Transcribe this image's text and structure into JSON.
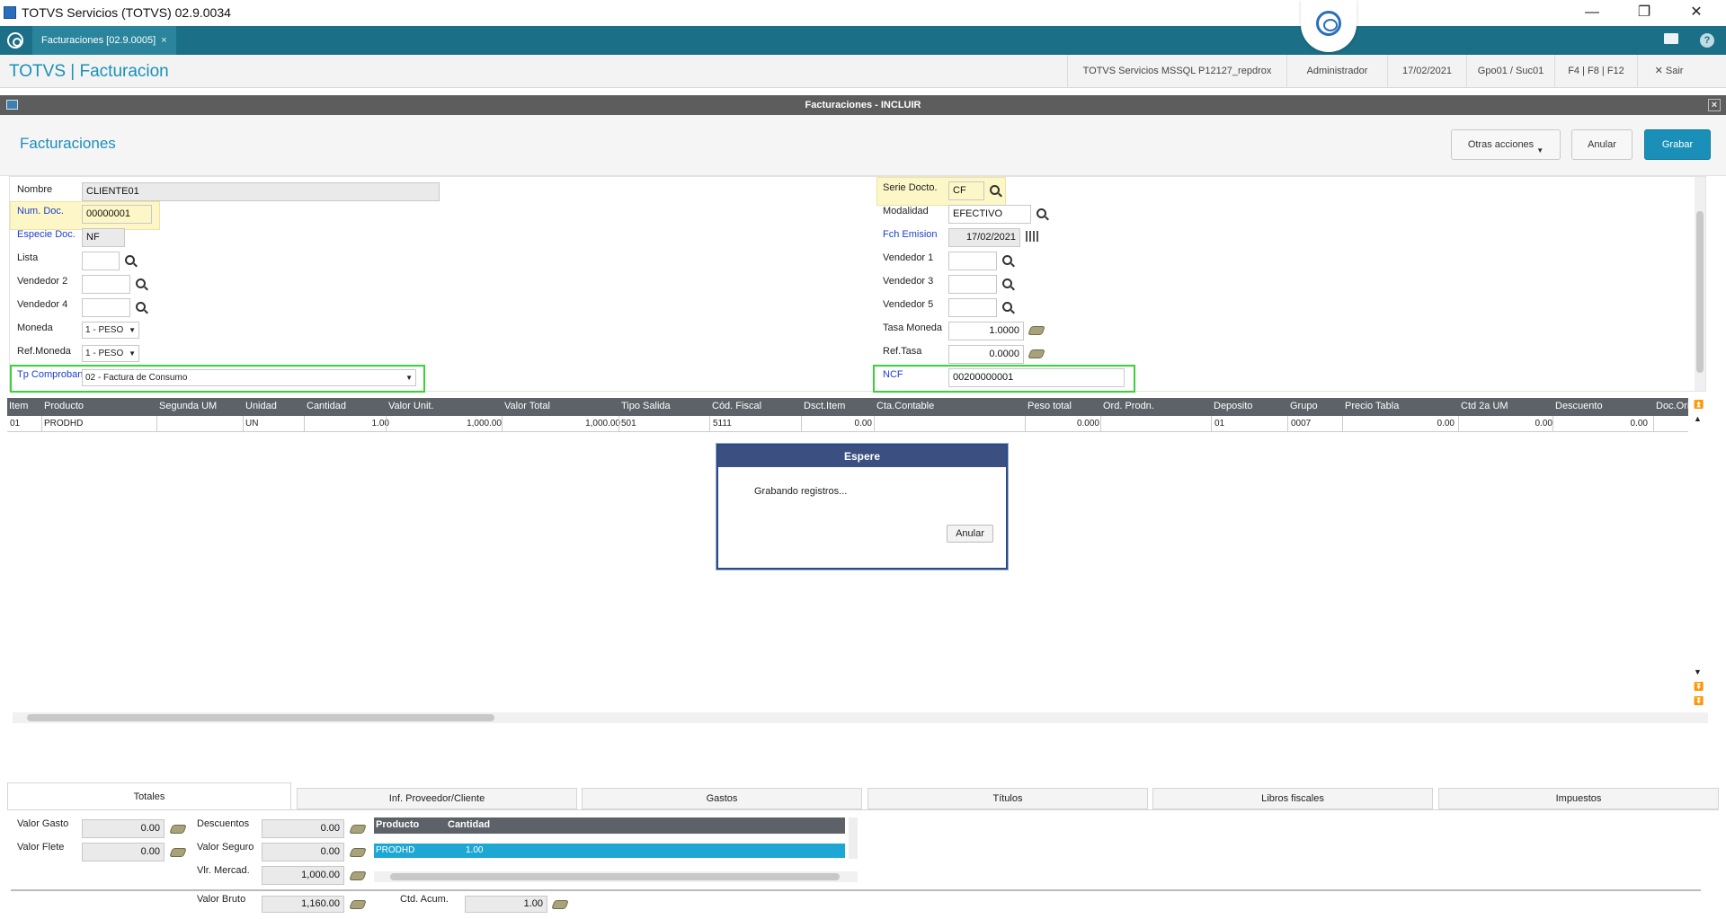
{
  "window": {
    "title": "TOTVS Servicios (TOTVS) 02.9.0034",
    "minimize": "—",
    "restore": "❐",
    "close": "✕"
  },
  "tabbar": {
    "tab_label": "Facturaciones [02.9.0005]",
    "tab_close": "×"
  },
  "header": {
    "brand": "TOTVS | Facturacion",
    "server": "TOTVS Servicios MSSQL P12127_repdrox",
    "user": "Administrador",
    "date": "17/02/2021",
    "branch": "Gpo01 / Suc01",
    "keys": "F4 | F8 | F12",
    "exit": "Sair"
  },
  "dialog": {
    "title": "Facturaciones - INCLUIR",
    "close": "×"
  },
  "form": {
    "title": "Facturaciones",
    "actions": {
      "other": "Otras acciones",
      "cancel": "Anular",
      "save": "Grabar"
    },
    "left": {
      "nombre": {
        "label": "Nombre",
        "value": "CLIENTE01"
      },
      "num_doc": {
        "label": "Num. Doc.",
        "value": "00000001"
      },
      "especie": {
        "label": "Especie Doc.",
        "value": "NF"
      },
      "lista": {
        "label": "Lista",
        "value": ""
      },
      "vendedor2": {
        "label": "Vendedor 2",
        "value": ""
      },
      "vendedor4": {
        "label": "Vendedor 4",
        "value": ""
      },
      "moneda": {
        "label": "Moneda",
        "value": "1 - PESO"
      },
      "ref_moneda": {
        "label": "Ref.Moneda",
        "value": "1 - PESO"
      },
      "tp_comprob": {
        "label": "Tp Comproban",
        "value": "02 - Factura de Consumo"
      }
    },
    "right": {
      "serie": {
        "label": "Serie Docto.",
        "value": "CF"
      },
      "modalidad": {
        "label": "Modalidad",
        "value": "EFECTIVO"
      },
      "fch_emision": {
        "label": "Fch Emision",
        "value": "17/02/2021"
      },
      "vendedor1": {
        "label": "Vendedor 1",
        "value": ""
      },
      "vendedor3": {
        "label": "Vendedor 3",
        "value": ""
      },
      "vendedor5": {
        "label": "Vendedor 5",
        "value": ""
      },
      "tasa_moneda": {
        "label": "Tasa Moneda",
        "value": "1.0000"
      },
      "ref_tasa": {
        "label": "Ref.Tasa",
        "value": "0.0000"
      },
      "ncf": {
        "label": "NCF",
        "value": "00200000001"
      }
    }
  },
  "grid": {
    "columns": [
      "Item",
      "Producto",
      "Segunda UM",
      "Unidad",
      "Cantidad",
      "Valor Unit.",
      "Valor Total",
      "Tipo Salida",
      "Cód. Fiscal",
      "Dsct.Item",
      "Cta.Contable",
      "Peso total",
      "Ord. Prodn.",
      "Deposito",
      "Grupo",
      "Precio Tabla",
      "Ctd 2a UM",
      "Descuento",
      "Doc.Origi"
    ],
    "rows": [
      [
        "01",
        "PRODHD",
        "",
        "UN",
        "1.00",
        "1,000.00",
        "1,000.00",
        "501",
        "5111",
        "0.00",
        "",
        "0.000",
        "",
        "01",
        "0007",
        "0.00",
        "0.00",
        "0.00",
        ""
      ]
    ]
  },
  "wait_dialog": {
    "title": "Espere",
    "message": "Grabando registros...",
    "cancel": "Anular"
  },
  "bottom_tabs": [
    "Totales",
    "Inf. Proveedor/Cliente",
    "Gastos",
    "Títulos",
    "Libros fiscales",
    "Impuestos"
  ],
  "totals": {
    "valor_gasto": {
      "label": "Valor Gasto",
      "value": "0.00"
    },
    "valor_flete": {
      "label": "Valor Flete",
      "value": "0.00"
    },
    "descuentos": {
      "label": "Descuentos",
      "value": "0.00"
    },
    "valor_seguro": {
      "label": "Valor Seguro",
      "value": "0.00"
    },
    "vlr_mercad": {
      "label": "Vlr. Mercad.",
      "value": "1,000.00"
    },
    "valor_bruto": {
      "label": "Valor Bruto",
      "value": "1,160.00"
    },
    "ctd_acum": {
      "label": "Ctd. Acum.",
      "value": "1.00"
    },
    "mini_grid": {
      "columns": [
        "Producto",
        "Cantidad"
      ],
      "row": [
        "PRODHD",
        "1.00"
      ]
    }
  }
}
